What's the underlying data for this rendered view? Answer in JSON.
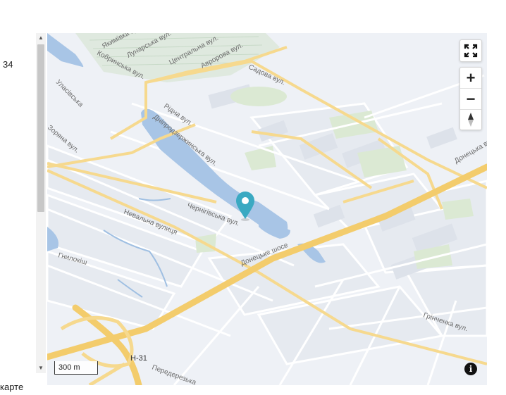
{
  "page": {
    "left_number": "34",
    "left_bottom_text": "карте"
  },
  "map": {
    "street_labels": {
      "yakimivka": "Якимівка вул.",
      "lunarska": "Лунарська вул.",
      "tsentralna": "Центральна вул.",
      "avrorna": "Авророва вул.",
      "sadova": "Садова вул.",
      "ulmivska": "Уласівська",
      "ridna": "Рідна вул.",
      "dniprodzerzhynska": "Дніпродзержинська вул.",
      "chernihivska": "Чернігівська вул.",
      "nevalna": "Невальна вулиця",
      "donetske_shose": "Донецьке шосе",
      "hrinchenka": "Грінченка вул.",
      "hnylokisha": "Гнилокіш",
      "perederezka": "Передерезька",
      "highway": "Н-31",
      "donetska_right": "Донецька вул.",
      "kryvosynska": "Кривосинська",
      "left_rotated_1": "Зоряна вул.",
      "left_rotated_2": "Уманська вул.",
      "top_left": "Кобринська вул."
    },
    "scale_label": "300 m",
    "colors": {
      "water": "#a8c5e6",
      "water_stroke": "#7fa9d9",
      "road_major": "#f6d98e",
      "road_highway": "#f3cc6c",
      "road_minor": "#ffffff",
      "park": "#dbe9d3",
      "block": "#e4e8ee",
      "pin": "#3aa9c2"
    },
    "icons": {
      "fullscreen": "expand-arrows-icon",
      "zoom_in": "plus-icon",
      "zoom_out": "minus-icon",
      "compass": "north-arrow-icon",
      "info": "info-icon",
      "pin": "location-pin-icon"
    },
    "zoom_in_label": "+",
    "zoom_out_label": "−",
    "info_label": "i"
  }
}
